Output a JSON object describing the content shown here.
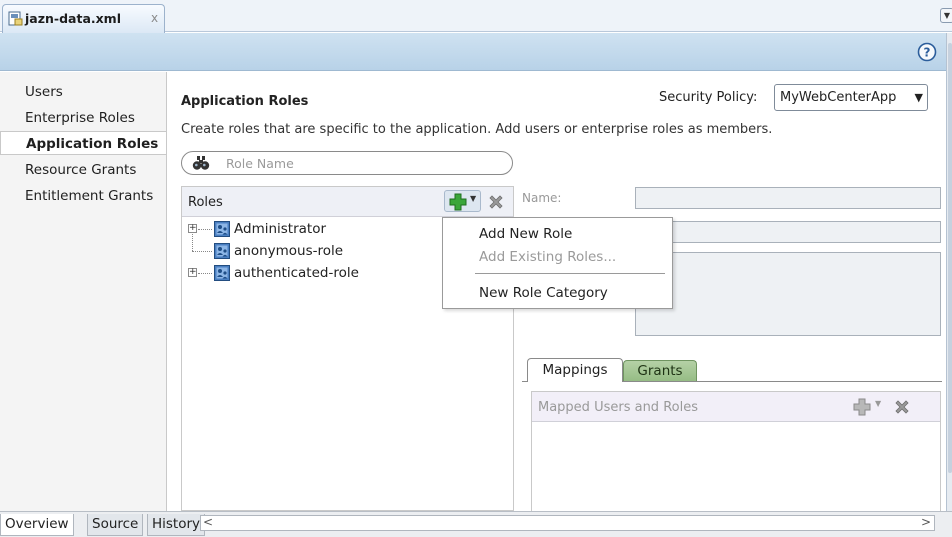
{
  "editor_tab": {
    "title": "jazn-data.xml",
    "close": "x"
  },
  "nav": {
    "items": [
      {
        "label": "Users"
      },
      {
        "label": "Enterprise Roles"
      },
      {
        "label": "Application Roles",
        "selected": true
      },
      {
        "label": "Resource Grants"
      },
      {
        "label": "Entitlement Grants"
      }
    ]
  },
  "main": {
    "section_title": "Application Roles",
    "description": "Create roles that are specific to the application.  Add users or enterprise roles as members.",
    "security_policy_label": "Security Policy:",
    "security_policy_value": "MyWebCenterApp",
    "search_placeholder": "Role Name",
    "roles_header": "Roles",
    "roles": [
      {
        "label": "Administrator",
        "expandable": true
      },
      {
        "label": "anonymous-role",
        "expandable": false
      },
      {
        "label": "authenticated-role",
        "expandable": true
      }
    ],
    "name_label": "Name:",
    "tabs": [
      {
        "label": "Mappings",
        "active": true
      },
      {
        "label": "Grants"
      }
    ],
    "mapped_header": "Mapped Users and Roles"
  },
  "popup_menu": {
    "items": [
      {
        "label": "Add New Role",
        "enabled": true
      },
      {
        "label": "Add Existing Roles...",
        "enabled": false
      },
      {
        "label": "New Role Category",
        "enabled": true
      }
    ]
  },
  "bottom_tabs": [
    {
      "label": "Overview",
      "active": true
    },
    {
      "label": "Source"
    },
    {
      "label": "History"
    }
  ],
  "icons": {
    "help": "help-icon",
    "search": "binoculars-icon",
    "add": "green-plus-icon",
    "delete": "gray-x-icon",
    "role": "app-role-icon"
  },
  "colors": {
    "toolbar": "#c5dbee",
    "grants_tab": "#a3c693",
    "add_green": "#3aa63a"
  }
}
